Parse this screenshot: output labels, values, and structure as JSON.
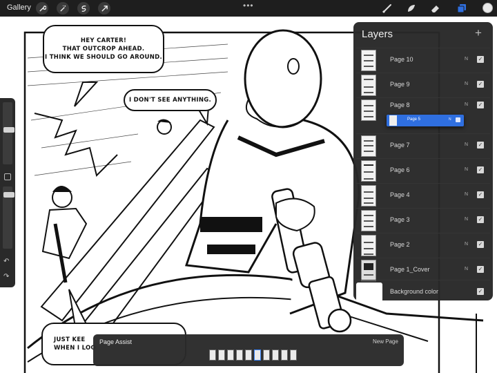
{
  "topbar": {
    "gallery_label": "Gallery",
    "left_tools": [
      "wrench-icon",
      "magic-wand-icon",
      "selection-icon",
      "transform-arrow-icon"
    ],
    "more_label": "•••",
    "right_tools": [
      "brush-icon",
      "smudge-icon",
      "eraser-icon",
      "layers-icon",
      "color-swatch"
    ],
    "active_tool": "layers-icon",
    "current_color": "#e8e8e8"
  },
  "comic": {
    "bubble1": [
      "HEY CARTER!",
      "THAT OUTCROP AHEAD.",
      "I THINK WE SHOULD GO AROUND."
    ],
    "bubble2": "I DON'T SEE ANYTHING.",
    "bubble3": [
      "JUST KEE",
      "WHEN I LOO"
    ]
  },
  "layers": {
    "title": "Layers",
    "add_label": "+",
    "items": [
      {
        "name": "Page 10",
        "blend": "N",
        "visible": true
      },
      {
        "name": "Page 9",
        "blend": "N",
        "visible": true
      },
      {
        "name": "Page 8",
        "blend": "N",
        "visible": true
      },
      {
        "name": "Page 7",
        "blend": "N",
        "visible": true
      },
      {
        "name": "Page 6",
        "blend": "N",
        "visible": true
      },
      {
        "name": "Page 4",
        "blend": "N",
        "visible": true
      },
      {
        "name": "Page 3",
        "blend": "N",
        "visible": true
      },
      {
        "name": "Page 2",
        "blend": "N",
        "visible": true
      },
      {
        "name": "Page 1_Cover",
        "blend": "N",
        "visible": true
      }
    ],
    "background_label": "Background color",
    "dragging": {
      "name": "Page 5",
      "blend": "N"
    }
  },
  "page_assist": {
    "title": "Page Assist",
    "new_page_label": "New Page",
    "page_count": 10,
    "selected_index": 5
  },
  "colors": {
    "accent": "#2f6fe0",
    "panel": "#282828"
  }
}
